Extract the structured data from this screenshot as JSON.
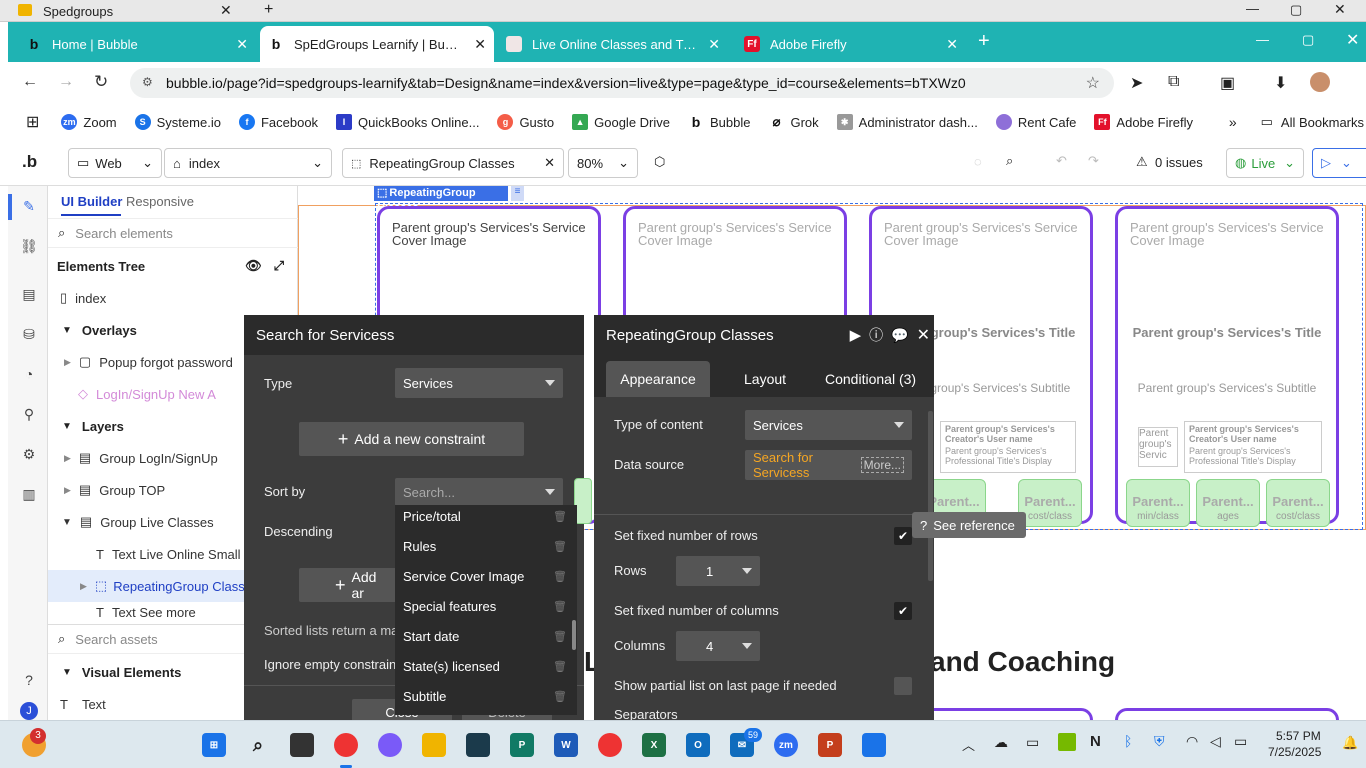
{
  "os_window": {
    "title": "Spedgroups"
  },
  "browser": {
    "tabs": [
      {
        "label": "Home | Bubble",
        "icon": "bubble-b"
      },
      {
        "label": "SpEdGroups Learnify | Bubble E",
        "icon": "bubble-b"
      },
      {
        "label": "Live Online Classes and Tutoring",
        "icon": "site"
      },
      {
        "label": "Adobe Firefly",
        "icon": "Ff"
      }
    ],
    "url": "bubble.io/page?id=spedgroups-learnify&tab=Design&name=index&version=live&type=page&type_id=course&elements=bTXWz0",
    "bookmarks": [
      "Zoom",
      "Systeme.io",
      "Facebook",
      "QuickBooks Online...",
      "Gusto",
      "Google Drive",
      "Bubble",
      "Grok",
      "Administrator dash...",
      "Rent Cafe",
      "Adobe Firefly"
    ],
    "all_bookmarks": "All Bookmarks"
  },
  "editor": {
    "logo": ".b",
    "platform": "Web",
    "page": "index",
    "selected_element": "RepeatingGroup Classes",
    "zoom": "80%",
    "issues": "0 issues",
    "live": "Live"
  },
  "panel": {
    "tabs": [
      "UI Builder",
      "Responsive"
    ],
    "search_placeholder": "Search elements",
    "tree_title": "Elements Tree",
    "index": "index",
    "overlays": "Overlays",
    "popup": "Popup forgot password",
    "login": "LogIn/SignUp New A",
    "layers": "Layers",
    "group_login": "Group LogIn/SignUp",
    "group_top": "Group TOP",
    "group_live": "Group Live Classes",
    "text_live": "Text Live Online Small C",
    "rg_classes": "RepeatingGroup Classe",
    "text_see_more": "Text See more",
    "assets_placeholder": "Search assets",
    "visual_elements": "Visual Elements",
    "text_item": "Text"
  },
  "canvas": {
    "rg_label": "RepeatingGroup Classes",
    "card_image": "Parent group's Services's Service Cover Image",
    "card_title": "Parent group's Services's Title",
    "card_subtitle": "Parent group's Services's Subtitle",
    "creator_name": "Parent group's Services's Creator's User name",
    "creator_title": "Parent group's Services's Professional Title's Display",
    "parent_short": "Parent group's Servic",
    "pill_label": "Parent...",
    "pills": [
      "min/class",
      "ages",
      "cost/class"
    ],
    "heading_frag": "and Coaching",
    "heading_left": "L"
  },
  "search_dialog": {
    "title": "Search for Servicess",
    "type_label": "Type",
    "type_value": "Services",
    "add_constraint": "Add a new constraint",
    "sort_by": "Sort by",
    "descending": "Descending",
    "add_another": "Add ar",
    "sorted_note": "Sorted lists return a ma",
    "ignore_empty": "Ignore empty constrain",
    "close": "Close",
    "delete": "Delete"
  },
  "sort_dropdown": {
    "placeholder": "Search...",
    "options": [
      "Price/total",
      "Rules",
      "Service Cover Image",
      "Special features",
      "Start date",
      "State(s) licensed",
      "Subtitle"
    ]
  },
  "property_editor": {
    "title": "RepeatingGroup Classes",
    "tabs": [
      "Appearance",
      "Layout",
      "Conditional (3)"
    ],
    "type_of_content_label": "Type of content",
    "type_of_content": "Services",
    "data_source_label": "Data source",
    "data_source": "Search for Servicess",
    "more": "More...",
    "see_reference": "See reference",
    "fixed_rows_label": "Set fixed number of rows",
    "rows_label": "Rows",
    "rows": "1",
    "fixed_cols_label": "Set fixed number of columns",
    "cols_label": "Columns",
    "cols": "4",
    "partial_label": "Show partial list on last page if needed",
    "separators": "Separators"
  },
  "taskbar": {
    "weather_badge": "3",
    "mail_badge": "59",
    "time": "5:57 PM",
    "date": "7/25/2025"
  },
  "colors": {
    "chrome": "#1fb3b3",
    "purple": "#7b3fe4",
    "orange": "#f5a623",
    "dialog": "#3c3c3c"
  }
}
